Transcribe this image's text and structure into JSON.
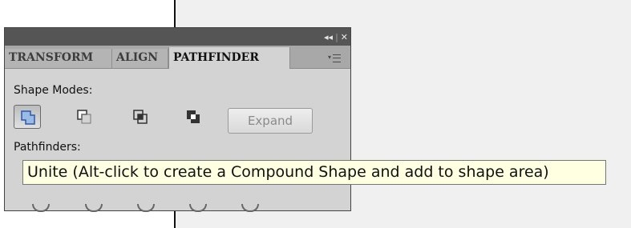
{
  "panel": {
    "titlebar": {
      "collapse_glyph": "◂◂",
      "divider": "|",
      "close_glyph": "✕"
    },
    "tabs": [
      {
        "label": "TRANSFORM",
        "active": false
      },
      {
        "label": "ALIGN",
        "active": false
      },
      {
        "label": "PATHFINDER",
        "active": true
      }
    ],
    "menu_icon": "panel-menu-icon",
    "shape_modes_label": "Shape Modes:",
    "shape_modes": [
      {
        "name": "unite",
        "icon": "unite-icon",
        "active": true
      },
      {
        "name": "minus-front",
        "icon": "minus-front-icon",
        "active": false
      },
      {
        "name": "intersect",
        "icon": "intersect-icon",
        "active": false
      },
      {
        "name": "exclude",
        "icon": "exclude-icon",
        "active": false
      }
    ],
    "expand_label": "Expand",
    "pathfinders_label": "Pathfinders:"
  },
  "tooltip": {
    "text": "Unite (Alt-click to create a Compound Shape and add to shape area)"
  },
  "colors": {
    "titlebar": "#555555",
    "panel_bg": "#d3d3d3",
    "tooltip_bg": "#ffffe1",
    "unite_fill": "#9bbbe6",
    "unite_stroke": "#2a5aa8"
  }
}
